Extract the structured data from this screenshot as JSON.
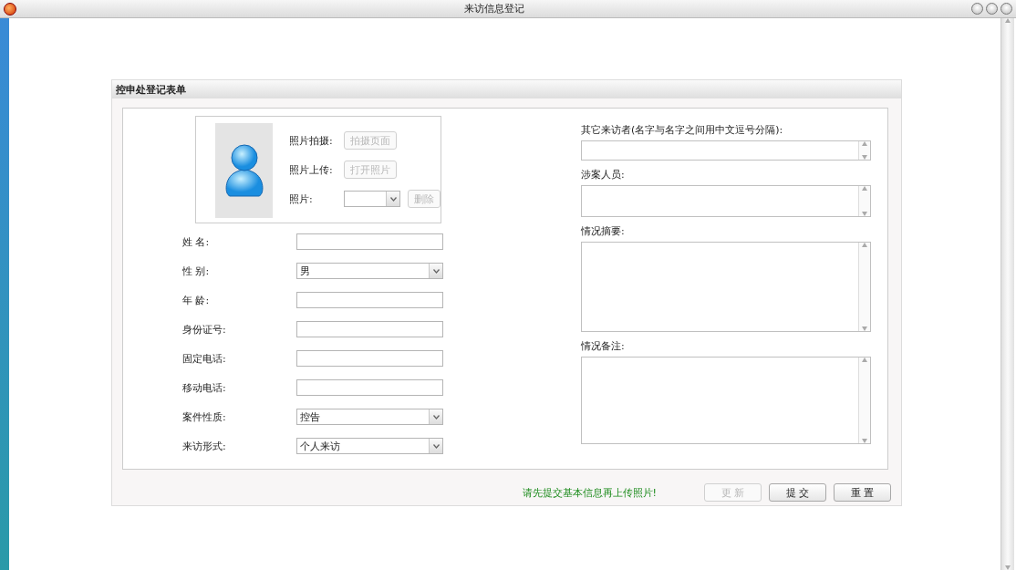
{
  "window": {
    "title": "来访信息登记"
  },
  "form": {
    "title": "控申处登记表单",
    "photo_rows": [
      {
        "label": "照片拍摄:",
        "button": {
          "label": "拍摄页面",
          "disabled": true
        }
      },
      {
        "label": "照片上传:",
        "button": {
          "label": "打开照片",
          "disabled": true
        }
      }
    ],
    "photo_select": {
      "label": "照片:",
      "button": {
        "label": "删除",
        "disabled": true
      }
    },
    "fields": [
      {
        "kind": "text",
        "label": "姓 名:"
      },
      {
        "kind": "select",
        "label": "性 别:",
        "value": "男"
      },
      {
        "kind": "text",
        "label": "年 龄:"
      },
      {
        "kind": "text",
        "label": "身份证号:"
      },
      {
        "kind": "text",
        "label": "固定电话:"
      },
      {
        "kind": "text",
        "label": "移动电话:"
      },
      {
        "kind": "select",
        "label": "案件性质:",
        "value": "控告"
      },
      {
        "kind": "select",
        "label": "来访形式:",
        "value": "个人来访"
      }
    ],
    "text_areas": [
      {
        "label": "其它来访者(名字与名字之间用中文逗号分隔):"
      },
      {
        "label": "涉案人员:"
      },
      {
        "label": "情况摘要:"
      },
      {
        "label": "情况备注:"
      }
    ],
    "message": "请先提交基本信息再上传照片!",
    "buttons": [
      {
        "label": "更 新",
        "disabled": true
      },
      {
        "label": "提 交",
        "disabled": false
      },
      {
        "label": "重 置",
        "disabled": false
      }
    ]
  }
}
